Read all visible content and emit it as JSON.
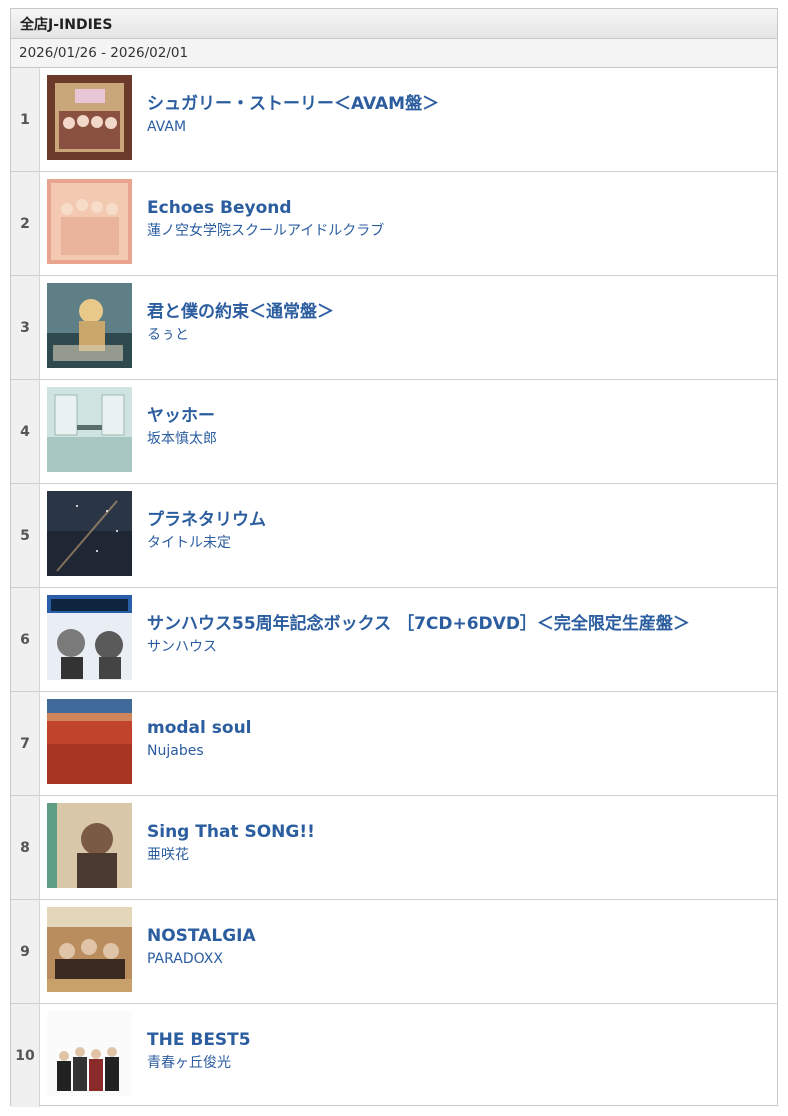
{
  "header": {
    "title": "全店J-INDIES"
  },
  "period": {
    "text": "2026/01/26 - 2026/02/01"
  },
  "items": [
    {
      "rank": "1",
      "title": "シュガリー・ストーリー＜AVAM盤＞",
      "artist": "AVAM"
    },
    {
      "rank": "2",
      "title": "Echoes Beyond",
      "artist": "蓮ノ空女学院スクールアイドルクラブ"
    },
    {
      "rank": "3",
      "title": "君と僕の約束＜通常盤＞",
      "artist": "るぅと"
    },
    {
      "rank": "4",
      "title": "ヤッホー",
      "artist": "坂本慎太郎"
    },
    {
      "rank": "5",
      "title": "プラネタリウム",
      "artist": "タイトル未定"
    },
    {
      "rank": "6",
      "title": "サンハウス55周年記念ボックス ［7CD+6DVD］＜完全限定生産盤＞",
      "artist": "サンハウス"
    },
    {
      "rank": "7",
      "title": "modal soul",
      "artist": "Nujabes"
    },
    {
      "rank": "8",
      "title": "Sing That SONG!!",
      "artist": "亜咲花"
    },
    {
      "rank": "9",
      "title": "NOSTALGIA",
      "artist": "PARADOXX"
    },
    {
      "rank": "10",
      "title": "THE BEST5",
      "artist": "青春ヶ丘俊光"
    }
  ]
}
